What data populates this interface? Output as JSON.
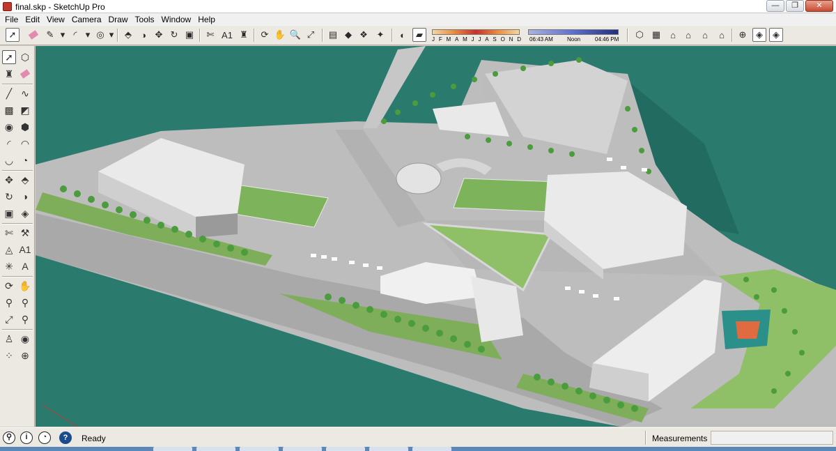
{
  "window": {
    "title": "final.skp - SketchUp Pro",
    "min_label": "—",
    "max_label": "❐",
    "close_label": "✕"
  },
  "menu": [
    "File",
    "Edit",
    "View",
    "Camera",
    "Draw",
    "Tools",
    "Window",
    "Help"
  ],
  "shadows": {
    "months": [
      "J",
      "F",
      "M",
      "A",
      "M",
      "J",
      "J",
      "A",
      "S",
      "O",
      "N",
      "D"
    ],
    "time_start": "06:43 AM",
    "time_mid": "Noon",
    "time_end": "04:46 PM"
  },
  "status": {
    "ready": "Ready",
    "measurements_label": "Measurements",
    "measurements_value": ""
  },
  "colors": {
    "water": "#2a7a6e",
    "ground": "#bdbdbd",
    "grass": "#7fae5a",
    "tree": "#4b9c3c",
    "building": "#eaeaea"
  },
  "icons": {
    "toolbar": [
      "select-icon",
      "eraser-icon",
      "pencil-icon",
      "arc-icon",
      "rotate-icon",
      "push-pull-icon",
      "move-icon",
      "offset-icon",
      "tape-icon",
      "text-icon",
      "paint-icon",
      "orbit-icon",
      "pan-icon",
      "zoom-icon",
      "zoom-extents-icon"
    ],
    "views": [
      "iso-view-icon",
      "top-view-icon",
      "front-view-icon",
      "right-view-icon",
      "back-view-icon",
      "left-view-icon"
    ]
  }
}
